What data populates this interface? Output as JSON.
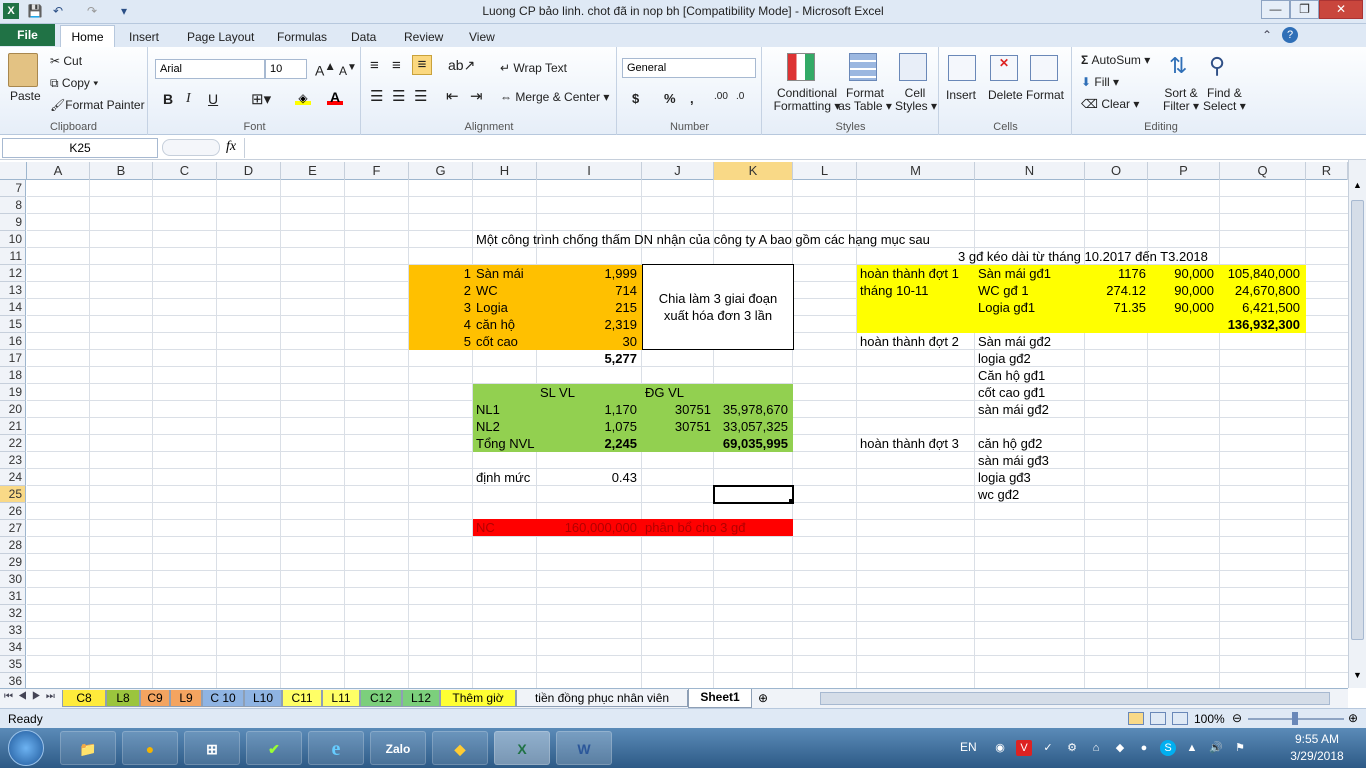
{
  "window": {
    "title": "Luong  CP bảo linh. chot đã in nop bh  [Compatibility Mode] - Microsoft Excel",
    "controls": {
      "minimize": "—",
      "restore": "❐",
      "close": "✕"
    }
  },
  "qat": {
    "save": "💾",
    "undo": "↶",
    "redo": "↷",
    "more": "▾"
  },
  "tabs": [
    "File",
    "Home",
    "Insert",
    "Page Layout",
    "Formulas",
    "Data",
    "Review",
    "View"
  ],
  "ribbon": {
    "clipboard": {
      "paste": "Paste",
      "cut": "Cut",
      "copy": "Copy",
      "format_painter": "Format Painter",
      "label": "Clipboard"
    },
    "font": {
      "name": "Arial",
      "size": "10",
      "bold": "B",
      "italic": "I",
      "underline": "U",
      "label": "Font"
    },
    "alignment": {
      "wrap": "Wrap Text",
      "merge": "Merge & Center",
      "label": "Alignment"
    },
    "number": {
      "format": "General",
      "currency": "$",
      "percent": "%",
      "comma": ",",
      "label": "Number"
    },
    "styles": {
      "conditional": "Conditional",
      "conditional2": "Formatting",
      "format_table": "Format",
      "format_table2": "as Table",
      "cell_styles": "Cell",
      "cell_styles2": "Styles",
      "label": "Styles"
    },
    "cells": {
      "insert": "Insert",
      "delete": "Delete",
      "format": "Format",
      "label": "Cells"
    },
    "editing": {
      "autosum": "AutoSum",
      "fill": "Fill",
      "clear": "Clear",
      "sort": "Sort &",
      "sort2": "Filter",
      "find": "Find &",
      "find2": "Select",
      "label": "Editing"
    }
  },
  "formula_bar": {
    "name_box": "K25",
    "fx": "fx",
    "value": ""
  },
  "columns": [
    "A",
    "B",
    "C",
    "D",
    "E",
    "F",
    "G",
    "H",
    "I",
    "J",
    "K",
    "L",
    "M",
    "N",
    "O",
    "P",
    "Q",
    "R"
  ],
  "rows": [
    "7",
    "8",
    "9",
    "10",
    "11",
    "12",
    "13",
    "14",
    "15",
    "16",
    "17",
    "18",
    "19",
    "20",
    "21",
    "22",
    "23",
    "24",
    "25",
    "26",
    "27",
    "28",
    "29",
    "30",
    "31",
    "32",
    "33",
    "34",
    "35",
    "36"
  ],
  "cells": {
    "h10": "Một công trình chống thấm DN nhận của công ty A  bao gồm các hạng mục sau",
    "n11": "3 gđ kéo dài từ tháng 10.2017 đến T3.2018",
    "orange": [
      {
        "num": "1",
        "name": "Sàn mái",
        "qty": "1,999"
      },
      {
        "num": "2",
        "name": "WC",
        "qty": "714"
      },
      {
        "num": "3",
        "name": "Logia",
        "qty": "215"
      },
      {
        "num": "4",
        "name": "căn hộ",
        "qty": "2,319"
      },
      {
        "num": "5",
        "name": "cốt cao",
        "qty": "30"
      }
    ],
    "total_qty": "5,277",
    "box_line1": "Chia làm 3 giai đoạn",
    "box_line2": "xuất hóa đơn 3 lần",
    "green_hdr_sl": "SL VL",
    "green_hdr_dg": "ĐG VL",
    "green": [
      {
        "name": "NL1",
        "sl": "1,170",
        "dg": "30751",
        "tt": "35,978,670"
      },
      {
        "name": "NL2",
        "sl": "1,075",
        "dg": "30751",
        "tt": "33,057,325"
      },
      {
        "name": "Tổng NVL",
        "sl": "2,245",
        "dg": "",
        "tt": "69,035,995"
      }
    ],
    "dinh_muc": "định mức",
    "dinh_muc_val": "0.43",
    "nc": "NC",
    "nc_val": "160,000,000",
    "nc_note": "phân bổ cho 3 gđ",
    "yellow": [
      {
        "m": "hoàn thành đợt 1",
        "n": "Sàn mái gđ1",
        "o": "1176",
        "p": "90,000",
        "q": "105,840,000"
      },
      {
        "m": "tháng 10-11",
        "n": "WC gđ 1",
        "o": "274.12",
        "p": "90,000",
        "q": "24,670,800"
      },
      {
        "m": "",
        "n": "Logia gđ1",
        "o": "71.35",
        "p": "90,000",
        "q": "6,421,500"
      }
    ],
    "yellow_total": "136,932,300",
    "phase2_label": "hoàn thành đợt 2",
    "phase2": [
      "Sàn mái gđ2",
      "logia gđ2",
      "Căn hộ gđ1",
      "cốt cao gđ1",
      "sàn mái gđ2"
    ],
    "phase3_label": "hoàn thành đợt 3",
    "phase3": [
      "căn hộ  gđ2",
      "sàn mái gđ3",
      "logia gđ3",
      "wc gđ2"
    ]
  },
  "sheet_tabs": [
    "C8",
    "L8",
    "C9",
    "L9",
    "C 10",
    "L10",
    "C11",
    "L11",
    "C12",
    "L12",
    "Thêm giờ",
    "tiền đồng phục nhân viên",
    "Sheet1"
  ],
  "sheet_tab_colors": [
    "#ffeb3b",
    "#9bc53d",
    "#f4a460",
    "#f4a460",
    "#8fb4e3",
    "#8fb4e3",
    "#ffff66",
    "#ffff66",
    "#7ccf7c",
    "#7ccf7c",
    "#ffff33",
    "#f0f3f8",
    "#ffffff"
  ],
  "status": {
    "ready": "Ready",
    "zoom": "100%"
  },
  "taskbar": {
    "lang": "EN",
    "time": "9:55 AM",
    "date": "3/29/2018",
    "apps": [
      "📁",
      "●",
      "⊞",
      "✔",
      "e",
      "Zalo",
      "◆",
      "X",
      "W"
    ]
  }
}
